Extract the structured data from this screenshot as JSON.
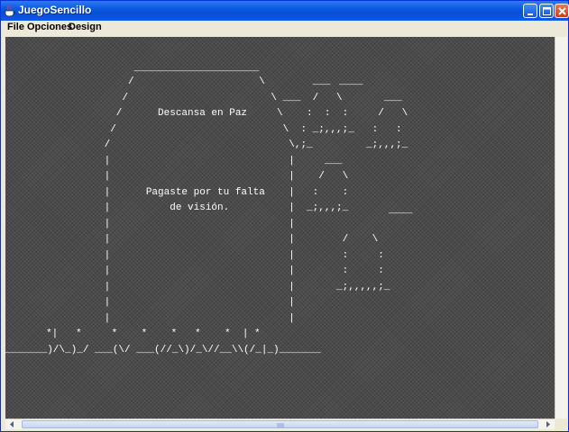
{
  "window": {
    "title": "JuegoSencillo"
  },
  "menubar": {
    "items": [
      "File",
      "Opciones",
      "Design"
    ]
  },
  "canvas": {
    "lines": [
      "           _____________________",
      "          /                     \\        ___",
      "         /                        \\ ___  /   \\       ___",
      "        /      Descansa en Paz     \\    :  :  :     /   \\",
      "       /                            \\  : _;,,,;_   :   :",
      "      /                              \\,;_         _;,,,;_",
      "      |                              |     ___",
      "      |                              |    /   \\",
      "      |      Pagaste por tu falta    |   :    :",
      "      |          de visión.          |  _;,,,;_",
      "      |                              |",
      "      |                              |        /    \\",
      "      |                              |        :     :",
      "      |                              |        :     :",
      "      |                              |       _;,,,,,;_",
      "      |                              |",
      "      |                              |",
      "     *|   *     *    *    *   *    *  | *",
      "_______)/\\_)_/ ___(\\/ ___(//_\\)/_\\//__\\\\(/_|_)_______"
    ],
    "extra_marks": [
      "____",
      "____"
    ]
  },
  "colors": {
    "titlebar": "#0a5ae0",
    "canvas_bg": "#4b4b4b",
    "ascii_fg": "#ffffff",
    "chrome": "#ece9d8"
  },
  "icons": {
    "app": "java-coffee-cup-icon",
    "minimize": "minimize-icon",
    "maximize": "maximize-icon",
    "close": "close-icon"
  }
}
